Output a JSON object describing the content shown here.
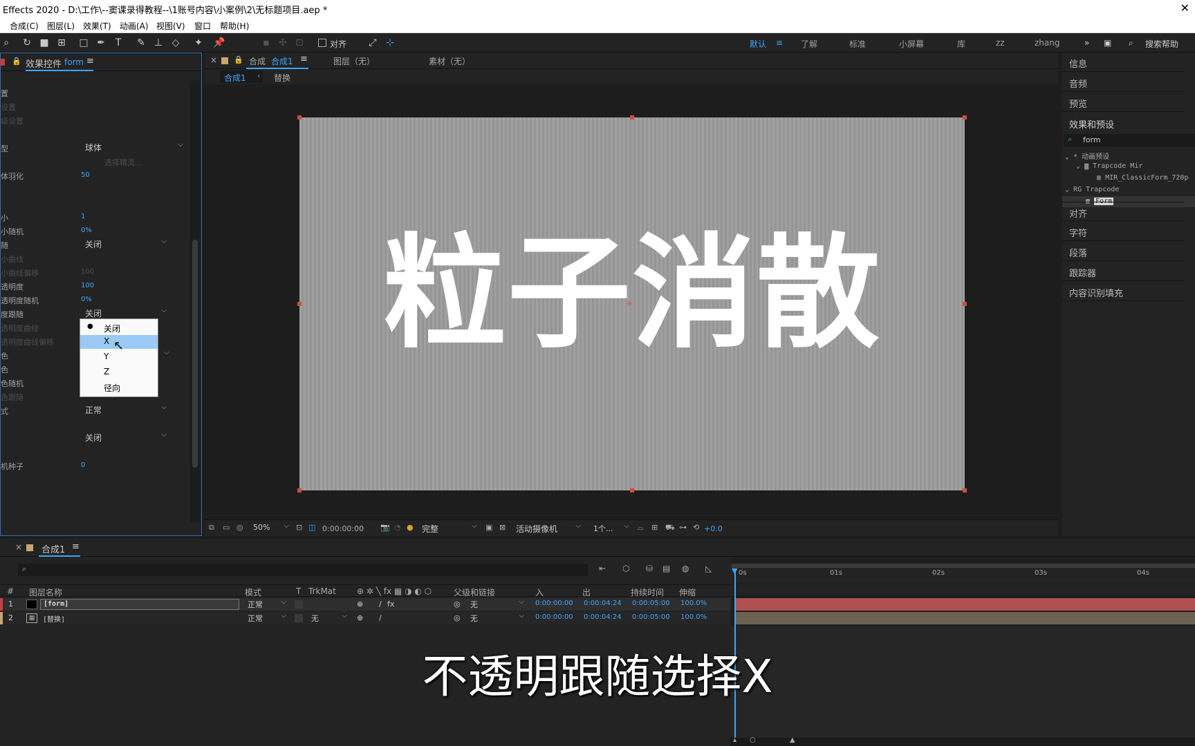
{
  "title": "Effects 2020 - D:\\工作\\--窦课录得教程--\\1账号内容\\小案例\\2\\无标题项目.aep *",
  "menu": [
    "合成(C)",
    "图层(L)",
    "效果(T)",
    "动画(A)",
    "视图(V)",
    "窗口",
    "帮助(H)"
  ],
  "toolbar": {
    "align_label": "对齐",
    "workspaces": [
      "默认",
      "了解",
      "标准",
      "小屏幕",
      "库",
      "zz",
      "zhang"
    ],
    "search_help": "搜索帮助"
  },
  "effect_panel": {
    "tab_label": "效果控件",
    "tab_layer": "form",
    "rows": [
      {
        "label": "置",
        "style": "normal"
      },
      {
        "label": "设置",
        "style": "dim"
      },
      {
        "label": "级设置",
        "style": "dim"
      },
      {
        "label": "型",
        "style": "normal",
        "dropdown": "球体"
      },
      {
        "label": "选择精灵...",
        "style": "dim-button"
      },
      {
        "label": "体羽化",
        "style": "normal",
        "value": "50"
      },
      {
        "label": "小",
        "style": "normal",
        "value": "1"
      },
      {
        "label": "小随机",
        "style": "normal",
        "value": "0%"
      },
      {
        "label": "随",
        "style": "normal",
        "dropdown": "关闭"
      },
      {
        "label": "小曲线",
        "style": "dim"
      },
      {
        "label": "小曲线偏移",
        "style": "dim",
        "value": "100"
      },
      {
        "label": "透明度",
        "style": "normal",
        "value": "100"
      },
      {
        "label": "透明度随机",
        "style": "normal",
        "value": "0%"
      },
      {
        "label": "度跟随",
        "style": "normal",
        "dropdown": "关闭"
      },
      {
        "label": "透明度曲线",
        "style": "dim"
      },
      {
        "label": "透明度曲线偏移",
        "style": "dim"
      },
      {
        "label": "色",
        "style": "normal"
      },
      {
        "label": "色",
        "style": "normal"
      },
      {
        "label": "色随机",
        "style": "normal"
      },
      {
        "label": "色跟随",
        "style": "dim"
      },
      {
        "label": "式",
        "style": "normal",
        "dropdown": "正常"
      },
      {
        "label": "",
        "style": "normal",
        "dropdown": "关闭"
      },
      {
        "label": "机种子",
        "style": "normal",
        "value": "0"
      }
    ],
    "popup_options": [
      "关闭",
      "X",
      "Y",
      "Z",
      "径向"
    ],
    "popup_selected": "关闭",
    "popup_hover": "X"
  },
  "comp_panel": {
    "tab_prefix": "合成",
    "tab_name": "合成1",
    "layer_tab": "图层（无）",
    "footage_tab": "素材（无）",
    "sub_tab_active": "合成1",
    "sub_tab_other": "替换",
    "canvas_text": "粒子消散",
    "bottom": {
      "zoom": "50%",
      "timecode": "0:00:00:00",
      "resolution": "完整",
      "camera": "活动摄像机",
      "views": "1个...",
      "exposure": "+0.0"
    }
  },
  "right_panel": {
    "items_top": [
      "信息",
      "音频",
      "预览"
    ],
    "effects_title": "效果和预设",
    "search_value": "form",
    "tree": [
      {
        "label": "* 动画预设",
        "indent": 0
      },
      {
        "label": "Trapcode Mir",
        "indent": 1
      },
      {
        "label": "MIR_ClassicForm_720p",
        "indent": 2
      },
      {
        "label": "RG Trapcode",
        "indent": 0
      },
      {
        "label": "Form",
        "indent": 1
      }
    ],
    "items_bottom": [
      "对齐",
      "字符",
      "段落",
      "跟踪器",
      "内容识别填充"
    ]
  },
  "timeline": {
    "tab": "合成1",
    "headers": {
      "num": "#",
      "name": "图层名称",
      "mode": "模式",
      "t": "T",
      "trkmat": "TrkMat",
      "parent": "父级和链接",
      "in": "入",
      "out": "出",
      "duration": "持续时间",
      "stretch": "伸缩"
    },
    "ruler": [
      "0s",
      "01s",
      "02s",
      "03s",
      "04s"
    ],
    "layers": [
      {
        "num": "1",
        "name": "[form]",
        "mode": "正常",
        "trkmat": "",
        "parent": "无",
        "in": "0:00:00:00",
        "out": "0:00:04:24",
        "duration": "0:00:05:00",
        "stretch": "100.0%"
      },
      {
        "num": "2",
        "name": "[替换]",
        "mode": "正常",
        "trkmat": "无",
        "parent": "无",
        "in": "0:00:00:00",
        "out": "0:00:04:24",
        "duration": "0:00:05:00",
        "stretch": "100.0%"
      }
    ]
  },
  "subtitle": "不透明跟随选择X"
}
